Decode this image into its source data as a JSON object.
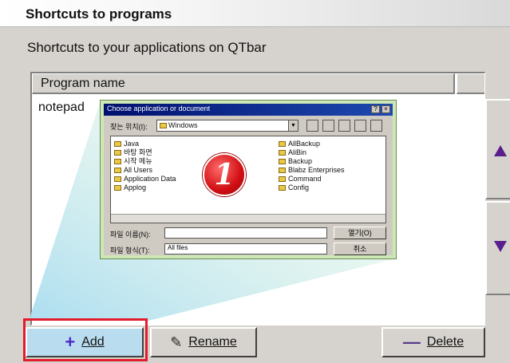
{
  "header": {
    "title": "Shortcuts to programs"
  },
  "subtitle": "Shortcuts to your applications on QTbar",
  "list": {
    "column_header": "Program name",
    "items": [
      "notepad"
    ]
  },
  "buttons": {
    "add_label": "Add",
    "rename_label": "Rename",
    "delete_label": "Delete"
  },
  "dialog": {
    "title": "Choose application or document",
    "look_in_label": "찾는 위치(I):",
    "look_in_value": "Windows",
    "files_left": [
      "Java",
      "바탕 화면",
      "시작 메뉴",
      "All Users",
      "Application Data",
      "Applog"
    ],
    "files_right": [
      "AllBackup",
      "AliBin",
      "Backup",
      "Blabz Enterprises",
      "Command",
      "Config"
    ],
    "filename_label": "파일 이름(N):",
    "filetype_label": "파일 형식(T):",
    "filetype_value": "All files",
    "open_button": "열기(O)",
    "cancel_button": "취소",
    "badge_number": "1"
  },
  "colors": {
    "highlight_border": "#e41b2a",
    "arrow": "#5a1f8c"
  }
}
